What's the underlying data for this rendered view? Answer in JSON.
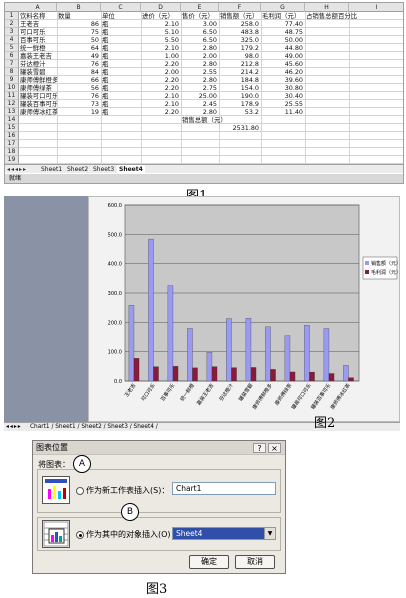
{
  "figure1": {
    "label": "图1",
    "col_letters": [
      "A",
      "B",
      "C",
      "D",
      "E",
      "F",
      "G",
      "H",
      "I"
    ],
    "headers": [
      "饮料名称",
      "数量",
      "单位",
      "进价（元）",
      "售价（元）",
      "销售额（元）",
      "毛利润（元）",
      "占销售总额百分比"
    ],
    "rows": [
      [
        "王老吉",
        "86",
        "瓶",
        "2.10",
        "3.00",
        "258.0",
        "77.40"
      ],
      [
        "可口可乐",
        "75",
        "瓶",
        "5.10",
        "6.50",
        "483.8",
        "48.75"
      ],
      [
        "百事可乐",
        "50",
        "瓶",
        "5.50",
        "6.50",
        "325.0",
        "50.00"
      ],
      [
        "统一鲜橙",
        "64",
        "瓶",
        "2.10",
        "2.80",
        "179.2",
        "44.80"
      ],
      [
        "嘉装王老吉",
        "49",
        "瓶",
        "1.00",
        "2.00",
        "98.0",
        "49.00"
      ],
      [
        "芬达橙汁",
        "76",
        "瓶",
        "2.20",
        "2.80",
        "212.8",
        "45.60"
      ],
      [
        "罐装雪碧",
        "84",
        "瓶",
        "2.00",
        "2.55",
        "214.2",
        "46.20"
      ],
      [
        "康师傅鲜橙多",
        "66",
        "瓶",
        "2.20",
        "2.80",
        "184.8",
        "39.60"
      ],
      [
        "康师傅绿茶",
        "56",
        "瓶",
        "2.20",
        "2.75",
        "154.0",
        "30.80"
      ],
      [
        "罐装可口可乐",
        "76",
        "瓶",
        "2.10",
        "25.00",
        "190.0",
        "30.40"
      ],
      [
        "罐装百事可乐",
        "73",
        "瓶",
        "2.10",
        "2.45",
        "178.9",
        "25.55"
      ],
      [
        "康师傅冰红茶",
        "19",
        "瓶",
        "2.20",
        "2.80",
        "53.2",
        "11.40"
      ]
    ],
    "total_label": "销售总额（元）",
    "total_value": "2531.80",
    "sheet_tabs": [
      "Sheet1",
      "Sheet2",
      "Sheet3",
      "Sheet4"
    ],
    "active_tab": "Sheet4",
    "status": "就绪"
  },
  "figure2": {
    "label": "图2",
    "sheet_tabs_text": "Chart1 / Sheet1 / Sheet2 / Sheet3 / Sheet4 /"
  },
  "chart_data": {
    "type": "bar",
    "categories": [
      "王老吉",
      "可口可乐",
      "百事可乐",
      "统一鲜橙",
      "嘉装王老吉",
      "芬达橙汁",
      "罐装雪碧",
      "康师傅鲜橙多",
      "康师傅绿茶",
      "罐装可口可乐",
      "罐装百事可乐",
      "康师傅冰红茶"
    ],
    "series": [
      {
        "name": "销售额（元）",
        "values": [
          258.0,
          483.8,
          325.0,
          179.2,
          98.0,
          212.8,
          214.2,
          184.8,
          154.0,
          190.0,
          178.9,
          53.2
        ],
        "color": "#9a9af2"
      },
      {
        "name": "毛利润（元）",
        "values": [
          77.4,
          48.75,
          50.0,
          44.8,
          49.0,
          45.6,
          46.2,
          39.6,
          30.8,
          30.4,
          25.55,
          11.4
        ],
        "color": "#8a1a3a"
      }
    ],
    "ylim": [
      0,
      600
    ],
    "yticks": [
      "0.0",
      "100.0",
      "200.0",
      "300.0",
      "400.0",
      "500.0",
      "600.0"
    ],
    "grid": true,
    "legend": "right",
    "plot_bg": "#c8c8c8"
  },
  "figure3": {
    "label": "图3",
    "title": "图表位置",
    "help": "?",
    "close": "×",
    "prompt": "将图表：",
    "option_new_sheet": "作为新工作表插入(S)：",
    "option_new_sheet_value": "Chart1",
    "option_object": "作为其中的对象插入(O)：",
    "option_object_value": "Sheet4",
    "ok": "确定",
    "cancel": "取消",
    "callout_a": "A",
    "callout_b": "B"
  }
}
